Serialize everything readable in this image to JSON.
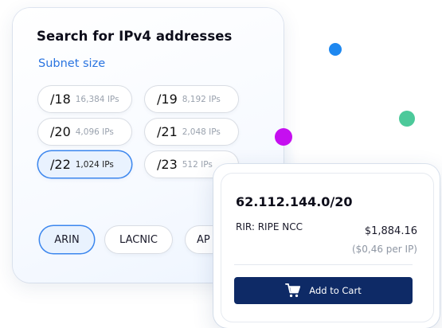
{
  "search": {
    "title": "Search for IPv4 addresses",
    "subnet_label": "Subnet size",
    "subnets": [
      {
        "prefix": "/18",
        "count": "16,384 IPs",
        "selected": false
      },
      {
        "prefix": "/19",
        "count": "8,192 IPs",
        "selected": false
      },
      {
        "prefix": "/20",
        "count": "4,096 IPs",
        "selected": false
      },
      {
        "prefix": "/21",
        "count": "2,048 IPs",
        "selected": false
      },
      {
        "prefix": "/22",
        "count": "1,024 IPs",
        "selected": true
      },
      {
        "prefix": "/23",
        "count": "512 IPs",
        "selected": false
      }
    ],
    "rirs": [
      {
        "label": "ARIN",
        "selected": true
      },
      {
        "label": "LACNIC",
        "selected": false
      },
      {
        "label": "AP",
        "selected": false
      }
    ]
  },
  "result": {
    "ip_block": "62.112.144.0/20",
    "rir": "RIR: RIPE NCC",
    "price": "$1,884.16",
    "per_ip": "($0,46 per IP)",
    "cart_label": "Add to Cart",
    "cart_icon": "cart-icon"
  },
  "colors": {
    "accent_blue": "#2a74e0",
    "selected_border": "#3b86ee",
    "button_navy": "#0e2a66",
    "dot_blue": "#1e88f0",
    "dot_green": "#4cc99a",
    "dot_purple": "#c50ff0"
  }
}
